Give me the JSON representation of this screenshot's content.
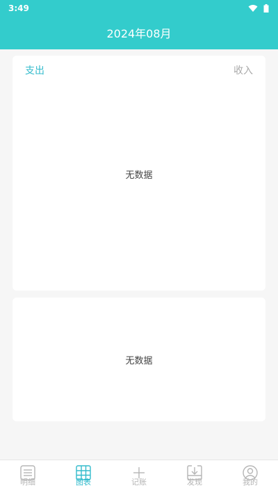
{
  "status_bar": {
    "time": "3:49"
  },
  "header": {
    "title": "2024年08月"
  },
  "chart_card": {
    "tabs": {
      "expense": "支出",
      "income": "收入"
    },
    "empty_text": "无数据"
  },
  "list_card": {
    "empty_text": "无数据"
  },
  "bottom_nav": {
    "items": [
      {
        "label": "明细",
        "icon": "list-icon"
      },
      {
        "label": "图表",
        "icon": "chart-grid-icon"
      },
      {
        "label": "记账",
        "icon": "plus-icon"
      },
      {
        "label": "发现",
        "icon": "discover-icon"
      },
      {
        "label": "我的",
        "icon": "profile-icon"
      }
    ],
    "active_index": 1
  },
  "colors": {
    "accent": "#33cccc",
    "active_text": "#33bbcc",
    "inactive_text": "#b5b5b5"
  }
}
